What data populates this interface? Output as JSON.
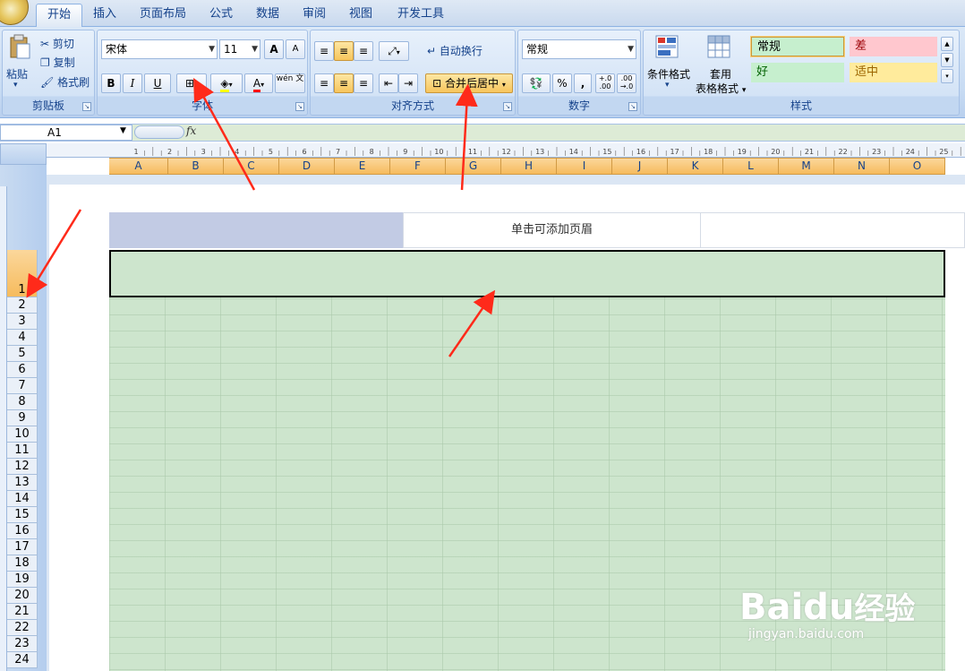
{
  "tabs": [
    "开始",
    "插入",
    "页面布局",
    "公式",
    "数据",
    "审阅",
    "视图",
    "开发工具"
  ],
  "clipboard": {
    "paste": "粘贴",
    "cut": "剪切",
    "copy": "复制",
    "format_painter": "格式刷",
    "label": "剪贴板"
  },
  "font": {
    "name": "宋体",
    "size": "11",
    "grow": "A",
    "shrink": "A",
    "bold": "B",
    "italic": "I",
    "underline": "U",
    "label": "字体",
    "phonetic": "wén 文"
  },
  "alignment": {
    "wrap": "自动换行",
    "merge": "合并后居中",
    "label": "对齐方式"
  },
  "number": {
    "format": "常规",
    "percent": "%",
    "comma": ",",
    "inc_decimal": "+.0 .00",
    "dec_decimal": ".00 →.0",
    "label": "数字"
  },
  "styles_group": {
    "cond_format": "条件格式",
    "table_format_1": "套用",
    "table_format_2": "表格格式",
    "label": "样式"
  },
  "cell_styles": {
    "normal": "常规",
    "bad": "差",
    "good": "好",
    "neutral": "适中"
  },
  "name_box": "A1",
  "fx": "fx",
  "columns": [
    "A",
    "B",
    "C",
    "D",
    "E",
    "F",
    "G",
    "H",
    "I",
    "J",
    "K",
    "L",
    "M",
    "N",
    "O"
  ],
  "rows": [
    "1",
    "2",
    "3",
    "4",
    "5",
    "6",
    "7",
    "8",
    "9",
    "10",
    "11",
    "12",
    "13",
    "14",
    "15",
    "16",
    "17",
    "18",
    "19",
    "20",
    "21",
    "22",
    "23",
    "24"
  ],
  "ruler_numbers": [
    "1",
    "2",
    "3",
    "4",
    "5",
    "6",
    "7",
    "8",
    "9",
    "10",
    "11",
    "12",
    "13",
    "14",
    "15",
    "16",
    "17",
    "18",
    "19",
    "20",
    "21",
    "22",
    "23",
    "24",
    "25"
  ],
  "header_placeholder": "单击可添加页眉",
  "watermark": {
    "brand": "Baidu",
    "brand_cn": "经验",
    "url": "jingyan.baidu.com"
  },
  "colors": {
    "accent_tab": "#15428b",
    "cell_fill": "#cde5cd",
    "style_bad": "#ffc7ce",
    "style_good": "#c6efce",
    "style_neutral": "#ffeb9c",
    "arrow": "#ff2a1a"
  }
}
